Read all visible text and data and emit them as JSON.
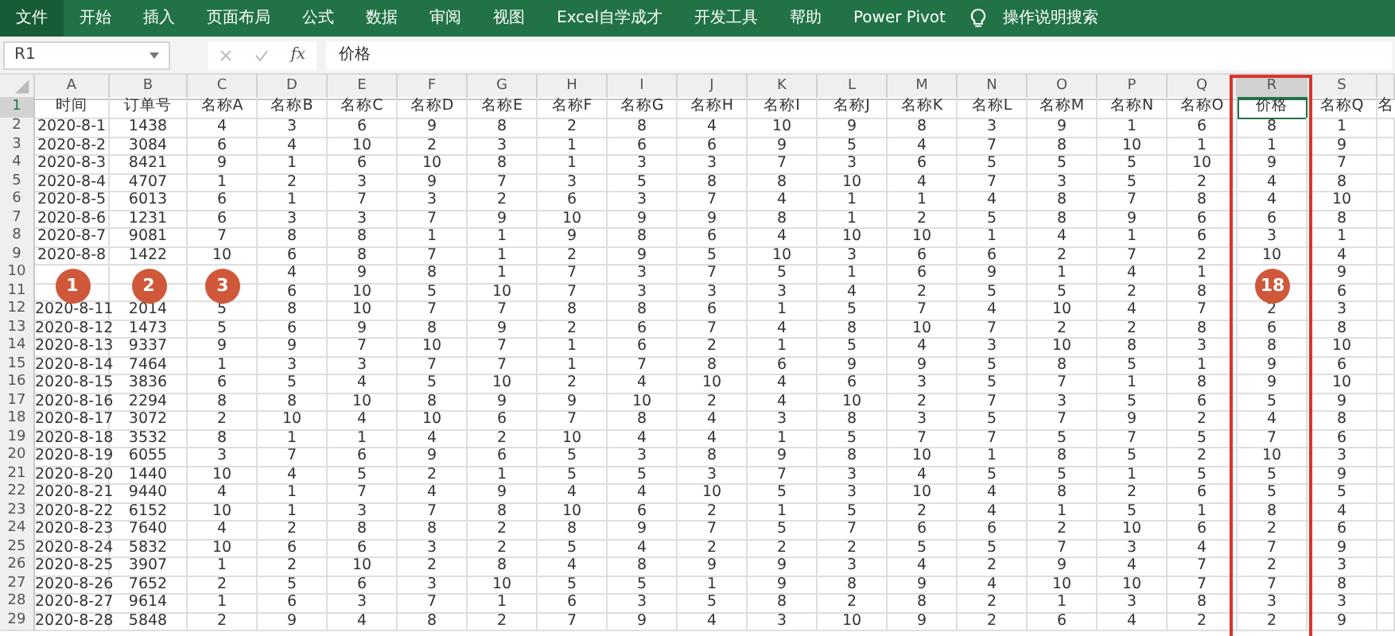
{
  "ribbon_tabs": [
    {
      "label": "文件",
      "selected": true
    },
    {
      "label": "开始",
      "selected": false
    },
    {
      "label": "插入",
      "selected": false
    },
    {
      "label": "页面布局",
      "selected": false
    },
    {
      "label": "公式",
      "selected": false
    },
    {
      "label": "数据",
      "selected": false
    },
    {
      "label": "审阅",
      "selected": false
    },
    {
      "label": "视图",
      "selected": false
    },
    {
      "label": "Excel自学成才",
      "selected": false
    },
    {
      "label": "开发工具",
      "selected": false
    },
    {
      "label": "帮助",
      "selected": false
    },
    {
      "label": "Power Pivot",
      "selected": false
    }
  ],
  "search": {
    "label": "操作说明搜索"
  },
  "formula_bar": {
    "name_box": "R1",
    "function_label": "fx",
    "value": "价格"
  },
  "columns": [
    {
      "letter": "A",
      "selected": false,
      "highlighted": false
    },
    {
      "letter": "B",
      "selected": false,
      "highlighted": false,
      "callout": "2"
    },
    {
      "letter": "C",
      "selected": false,
      "highlighted": false,
      "callout": "3"
    },
    {
      "letter": "D",
      "selected": false,
      "highlighted": false
    },
    {
      "letter": "E",
      "selected": false,
      "highlighted": false
    },
    {
      "letter": "F",
      "selected": false,
      "highlighted": false
    },
    {
      "letter": "G",
      "selected": false,
      "highlighted": false
    },
    {
      "letter": "H",
      "selected": false,
      "highlighted": false
    },
    {
      "letter": "I",
      "selected": false,
      "highlighted": false
    },
    {
      "letter": "J",
      "selected": false,
      "highlighted": false
    },
    {
      "letter": "K",
      "selected": false,
      "highlighted": false
    },
    {
      "letter": "L",
      "selected": false,
      "highlighted": false
    },
    {
      "letter": "M",
      "selected": false,
      "highlighted": false
    },
    {
      "letter": "N",
      "selected": false,
      "highlighted": false
    },
    {
      "letter": "O",
      "selected": false,
      "highlighted": false
    },
    {
      "letter": "P",
      "selected": false,
      "highlighted": false
    },
    {
      "letter": "Q",
      "selected": false,
      "highlighted": false
    },
    {
      "letter": "R",
      "selected": true,
      "highlighted": true,
      "callout": "18"
    },
    {
      "letter": "S",
      "selected": false,
      "highlighted": false
    }
  ],
  "first_column_callout": "1",
  "partial_header_cell": "名",
  "rows": [
    {
      "number": "1",
      "selected": true,
      "cells": [
        "时间",
        "订单号",
        "名称A",
        "名称B",
        "名称C",
        "名称D",
        "名称E",
        "名称F",
        "名称G",
        "名称H",
        "名称I",
        "名称J",
        "名称K",
        "名称L",
        "名称M",
        "名称N",
        "名称O",
        "价格",
        "名称Q"
      ]
    },
    {
      "number": "2",
      "selected": false,
      "cells": [
        "2020-8-1",
        "1438",
        "4",
        "3",
        "6",
        "9",
        "8",
        "2",
        "8",
        "4",
        "10",
        "9",
        "8",
        "3",
        "9",
        "1",
        "6",
        "8",
        "1"
      ]
    },
    {
      "number": "3",
      "selected": false,
      "cells": [
        "2020-8-2",
        "3084",
        "6",
        "4",
        "10",
        "2",
        "3",
        "1",
        "6",
        "6",
        "9",
        "5",
        "4",
        "7",
        "8",
        "10",
        "1",
        "1",
        "9"
      ]
    },
    {
      "number": "4",
      "selected": false,
      "cells": [
        "2020-8-3",
        "8421",
        "9",
        "1",
        "6",
        "10",
        "8",
        "1",
        "3",
        "3",
        "7",
        "3",
        "6",
        "5",
        "5",
        "5",
        "10",
        "9",
        "7"
      ]
    },
    {
      "number": "5",
      "selected": false,
      "cells": [
        "2020-8-4",
        "4707",
        "1",
        "2",
        "3",
        "9",
        "7",
        "3",
        "5",
        "8",
        "8",
        "10",
        "4",
        "7",
        "3",
        "5",
        "2",
        "4",
        "8"
      ]
    },
    {
      "number": "6",
      "selected": false,
      "cells": [
        "2020-8-5",
        "6013",
        "6",
        "1",
        "7",
        "3",
        "2",
        "6",
        "3",
        "7",
        "4",
        "1",
        "1",
        "4",
        "8",
        "7",
        "8",
        "4",
        "10"
      ]
    },
    {
      "number": "7",
      "selected": false,
      "cells": [
        "2020-8-6",
        "1231",
        "6",
        "3",
        "3",
        "7",
        "9",
        "10",
        "9",
        "9",
        "8",
        "1",
        "2",
        "5",
        "8",
        "9",
        "6",
        "6",
        "8"
      ]
    },
    {
      "number": "8",
      "selected": false,
      "cells": [
        "2020-8-7",
        "9081",
        "7",
        "8",
        "8",
        "1",
        "1",
        "9",
        "8",
        "6",
        "4",
        "10",
        "10",
        "1",
        "4",
        "1",
        "6",
        "3",
        "1"
      ]
    },
    {
      "number": "9",
      "selected": false,
      "cells": [
        "2020-8-8",
        "1422",
        "10",
        "6",
        "8",
        "7",
        "1",
        "2",
        "9",
        "5",
        "10",
        "3",
        "6",
        "6",
        "2",
        "7",
        "2",
        "10",
        "4"
      ]
    },
    {
      "number": "10",
      "selected": false,
      "cells": [
        null,
        null,
        null,
        "4",
        "9",
        "8",
        "1",
        "7",
        "3",
        "7",
        "5",
        "1",
        "6",
        "9",
        "1",
        "4",
        "1",
        null,
        "9"
      ]
    },
    {
      "number": "11",
      "selected": false,
      "cells": [
        null,
        null,
        null,
        "6",
        "10",
        "5",
        "10",
        "7",
        "3",
        "3",
        "3",
        "4",
        "2",
        "5",
        "5",
        "2",
        "8",
        null,
        "6"
      ]
    },
    {
      "number": "12",
      "selected": false,
      "cells": [
        "2020-8-11",
        "2014",
        "5",
        "8",
        "10",
        "7",
        "7",
        "8",
        "8",
        "6",
        "1",
        "5",
        "7",
        "4",
        "10",
        "4",
        "7",
        "2",
        "3"
      ]
    },
    {
      "number": "13",
      "selected": false,
      "cells": [
        "2020-8-12",
        "1473",
        "5",
        "6",
        "9",
        "8",
        "9",
        "2",
        "6",
        "7",
        "4",
        "8",
        "10",
        "7",
        "2",
        "2",
        "8",
        "6",
        "8"
      ]
    },
    {
      "number": "14",
      "selected": false,
      "cells": [
        "2020-8-13",
        "9337",
        "9",
        "9",
        "7",
        "10",
        "7",
        "1",
        "6",
        "2",
        "1",
        "5",
        "4",
        "3",
        "10",
        "8",
        "3",
        "8",
        "10"
      ]
    },
    {
      "number": "15",
      "selected": false,
      "cells": [
        "2020-8-14",
        "7464",
        "1",
        "3",
        "3",
        "7",
        "7",
        "1",
        "7",
        "8",
        "6",
        "9",
        "9",
        "5",
        "8",
        "5",
        "1",
        "9",
        "6"
      ]
    },
    {
      "number": "16",
      "selected": false,
      "cells": [
        "2020-8-15",
        "3836",
        "6",
        "5",
        "4",
        "5",
        "10",
        "2",
        "4",
        "10",
        "4",
        "6",
        "3",
        "5",
        "7",
        "1",
        "8",
        "9",
        "10"
      ]
    },
    {
      "number": "17",
      "selected": false,
      "cells": [
        "2020-8-16",
        "2294",
        "8",
        "8",
        "10",
        "8",
        "9",
        "9",
        "10",
        "2",
        "4",
        "10",
        "2",
        "7",
        "3",
        "5",
        "6",
        "5",
        "9"
      ]
    },
    {
      "number": "18",
      "selected": false,
      "cells": [
        "2020-8-17",
        "3072",
        "2",
        "10",
        "4",
        "10",
        "6",
        "7",
        "8",
        "4",
        "3",
        "8",
        "3",
        "5",
        "7",
        "9",
        "2",
        "4",
        "8"
      ]
    },
    {
      "number": "19",
      "selected": false,
      "cells": [
        "2020-8-18",
        "3532",
        "8",
        "1",
        "1",
        "4",
        "2",
        "10",
        "4",
        "4",
        "1",
        "5",
        "7",
        "7",
        "5",
        "7",
        "5",
        "7",
        "6"
      ]
    },
    {
      "number": "20",
      "selected": false,
      "cells": [
        "2020-8-19",
        "6055",
        "3",
        "7",
        "6",
        "9",
        "6",
        "5",
        "3",
        "8",
        "9",
        "8",
        "10",
        "1",
        "8",
        "5",
        "2",
        "10",
        "3"
      ]
    },
    {
      "number": "21",
      "selected": false,
      "cells": [
        "2020-8-20",
        "1440",
        "10",
        "4",
        "5",
        "2",
        "1",
        "5",
        "5",
        "3",
        "7",
        "3",
        "4",
        "5",
        "5",
        "1",
        "5",
        "5",
        "9"
      ]
    },
    {
      "number": "22",
      "selected": false,
      "cells": [
        "2020-8-21",
        "9440",
        "4",
        "1",
        "7",
        "4",
        "9",
        "4",
        "4",
        "10",
        "5",
        "3",
        "10",
        "4",
        "8",
        "2",
        "6",
        "5",
        "5"
      ]
    },
    {
      "number": "23",
      "selected": false,
      "cells": [
        "2020-8-22",
        "6152",
        "10",
        "1",
        "3",
        "7",
        "8",
        "10",
        "6",
        "2",
        "1",
        "5",
        "2",
        "4",
        "1",
        "5",
        "1",
        "8",
        "4"
      ]
    },
    {
      "number": "24",
      "selected": false,
      "cells": [
        "2020-8-23",
        "7640",
        "4",
        "2",
        "8",
        "8",
        "2",
        "8",
        "9",
        "7",
        "5",
        "7",
        "6",
        "6",
        "2",
        "10",
        "6",
        "2",
        "6"
      ]
    },
    {
      "number": "25",
      "selected": false,
      "cells": [
        "2020-8-24",
        "5832",
        "10",
        "6",
        "6",
        "3",
        "2",
        "5",
        "4",
        "2",
        "2",
        "2",
        "5",
        "5",
        "7",
        "3",
        "4",
        "7",
        "9"
      ]
    },
    {
      "number": "26",
      "selected": false,
      "cells": [
        "2020-8-25",
        "3907",
        "1",
        "2",
        "10",
        "2",
        "8",
        "4",
        "8",
        "9",
        "9",
        "3",
        "4",
        "2",
        "9",
        "4",
        "7",
        "2",
        "3"
      ]
    },
    {
      "number": "27",
      "selected": false,
      "cells": [
        "2020-8-26",
        "7652",
        "2",
        "5",
        "6",
        "3",
        "10",
        "5",
        "5",
        "1",
        "9",
        "8",
        "9",
        "4",
        "10",
        "10",
        "7",
        "7",
        "8"
      ]
    },
    {
      "number": "28",
      "selected": false,
      "cells": [
        "2020-8-27",
        "9614",
        "1",
        "6",
        "3",
        "7",
        "1",
        "6",
        "3",
        "5",
        "8",
        "2",
        "8",
        "2",
        "1",
        "3",
        "8",
        "3",
        "3"
      ]
    },
    {
      "number": "29",
      "selected": false,
      "cells": [
        "2020-8-28",
        "5848",
        "2",
        "9",
        "4",
        "8",
        "2",
        "7",
        "9",
        "4",
        "3",
        "10",
        "9",
        "2",
        "6",
        "4",
        "2",
        "2",
        "9"
      ]
    }
  ]
}
